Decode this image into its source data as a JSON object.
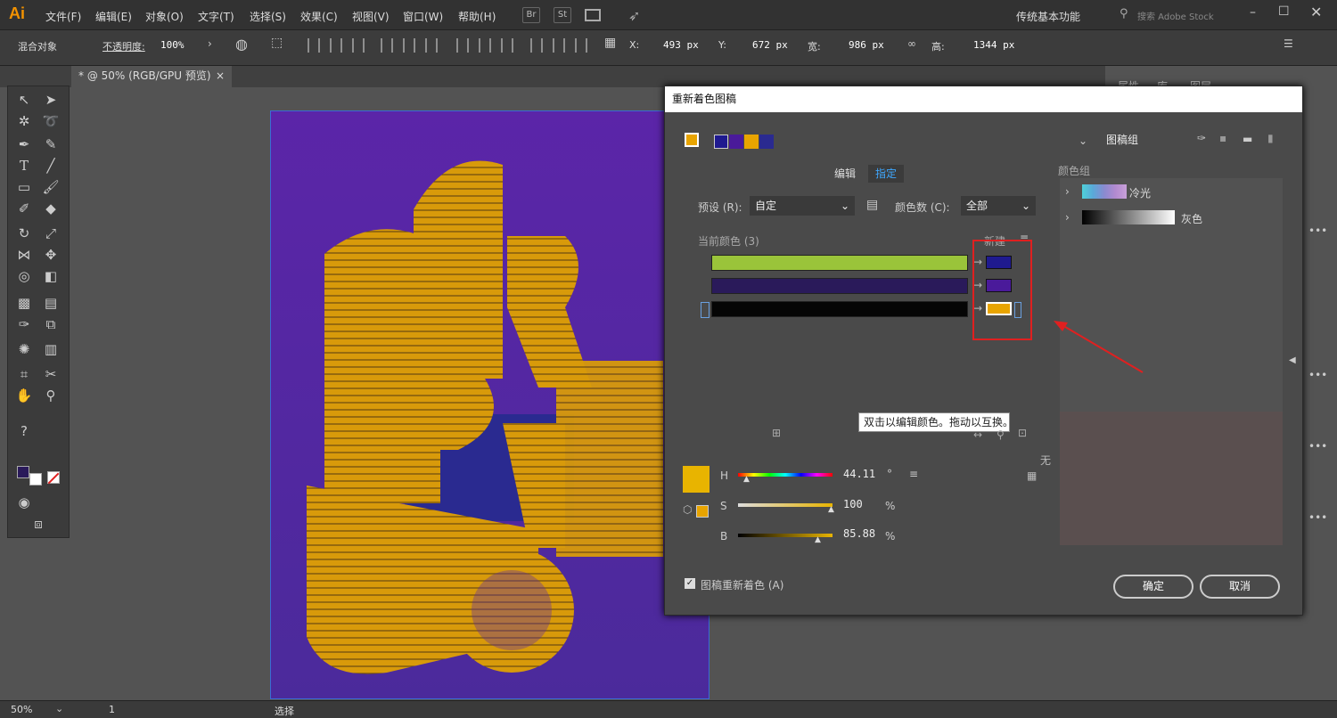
{
  "app": {
    "logo": "Ai",
    "workspace": "传统基本功能",
    "search_placeholder": "搜索 Adobe Stock"
  },
  "menu": [
    "文件(F)",
    "编辑(E)",
    "对象(O)",
    "文字(T)",
    "选择(S)",
    "效果(C)",
    "视图(V)",
    "窗口(W)",
    "帮助(H)"
  ],
  "menubar_buttons": [
    "Br",
    "St"
  ],
  "control": {
    "label_mixed": "混合对象",
    "opacity_label": "不透明度:",
    "opacity_value": "100%",
    "x_label": "X:",
    "x_value": "493 px",
    "y_label": "Y:",
    "y_value": "672 px",
    "w_label": "宽:",
    "w_value": "986 px",
    "h_label": "高:",
    "h_value": "1344 px"
  },
  "doc_tab": {
    "title": "@ 50% (RGB/GPU 预览)",
    "close": "×",
    "prefix": "*"
  },
  "right_panel_tabs": [
    "属性",
    "库",
    "图层"
  ],
  "status": {
    "zoom": "50%",
    "artboard": "1",
    "tool": "选择"
  },
  "dialog": {
    "title": "重新着色图稿",
    "artwork_group_label": "图稿组",
    "tabs": {
      "edit": "编辑",
      "assign": "指定"
    },
    "preset_label": "预设 (R):",
    "preset_value": "自定",
    "color_count_label": "颜色数 (C):",
    "color_count_value": "全部",
    "current_colors_label": "当前颜色 (3)",
    "new_label": "新建",
    "current_colors": [
      "#9ac43a",
      "#2a1a5a",
      "#050505"
    ],
    "new_colors": [
      "#1f1a8f",
      "#4a1a9a",
      "#e8a400"
    ],
    "tooltip": "双击以编辑颜色。拖动以互换。",
    "none_label": "无",
    "hsb": {
      "h_label": "H",
      "h_value": "44.11",
      "h_unit": "°",
      "s_label": "S",
      "s_value": "100",
      "s_unit": "%",
      "b_label": "B",
      "b_value": "85.88",
      "b_unit": "%"
    },
    "recolor_checkbox": "图稿重新着色 (A)",
    "ok": "确定",
    "cancel": "取消",
    "color_groups_label": "颜色组",
    "groups": [
      {
        "name": "冷光",
        "colors": [
          "#4fd1d9",
          "#5aa8d8",
          "#8a8ad0",
          "#b28ad0",
          "#c8a0d8"
        ]
      },
      {
        "name": "灰色",
        "colors": [
          "#000000",
          "#1a1a1a",
          "#333333",
          "#4d4d4d",
          "#666666",
          "#808080",
          "#999999",
          "#b3b3b3",
          "#cccccc",
          "#e6e6e6",
          "#ffffff"
        ]
      }
    ],
    "selected_color": "#e8b400"
  }
}
